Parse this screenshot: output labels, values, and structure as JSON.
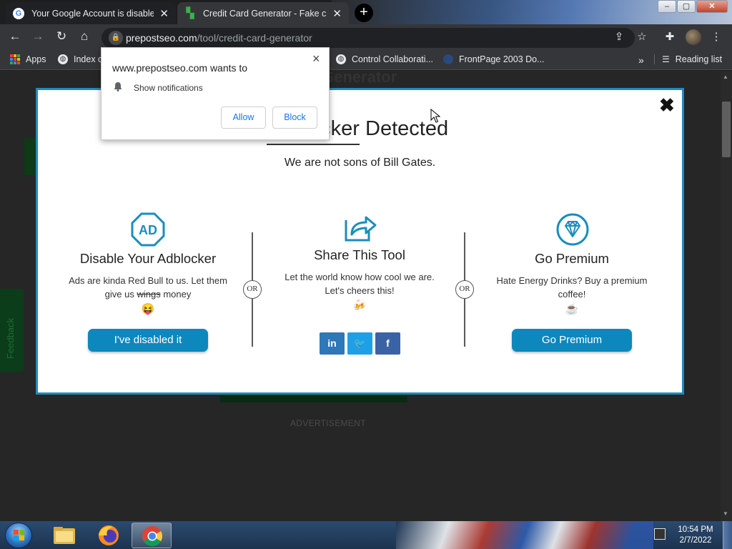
{
  "browser": {
    "tabs": [
      {
        "title": "Your Google Account is disabled",
        "favicon": "google-icon",
        "active": true
      },
      {
        "title": "Credit Card Generator - Fake cre",
        "favicon": "prepostseo-icon",
        "active": false
      }
    ],
    "new_tab": "+",
    "window_controls": {
      "minimize": "‒",
      "maximize": "▢",
      "close": "✕"
    },
    "url_host": "prepostseo.com",
    "url_path": "/tool/credit-card-generator",
    "bookmarks": [
      {
        "label": "Apps",
        "icon": "apps-grid-icon"
      },
      {
        "label": "Index c",
        "icon": "globe-icon"
      },
      {
        "label": "Control Collaborati...",
        "icon": "globe-icon"
      },
      {
        "label": "FrontPage 2003 Do...",
        "icon": "frontpage-icon"
      }
    ],
    "overflow": "»",
    "reading_list": "Reading list"
  },
  "notification": {
    "title": "www.prepostseo.com wants to",
    "permission": "Show notifications",
    "allow": "Allow",
    "block": "Block",
    "close": "×"
  },
  "modal": {
    "title": "Adblocker Detected",
    "subtitle": "We are not sons of Bill Gates.",
    "close": "✖",
    "or_label": "OR",
    "columns": [
      {
        "icon": "ad-octagon-icon",
        "heading": "Disable Your Adblocker",
        "text_before": "Ads are kinda Red Bull to us. Let them give us ",
        "strike": "wings",
        "text_after": " money",
        "emoji": "😝",
        "button": "I've disabled it"
      },
      {
        "icon": "share-icon",
        "heading": "Share This Tool",
        "text": "Let the world know how cool we are. Let's cheers this!",
        "emoji": "🍻",
        "share_buttons": [
          {
            "label": "in",
            "network": "linkedin",
            "color": "#2e77b8"
          },
          {
            "label": "🐦",
            "network": "twitter",
            "color": "#1ea0e8"
          },
          {
            "label": "f",
            "network": "facebook",
            "color": "#3a63a5"
          }
        ]
      },
      {
        "icon": "diamond-icon",
        "heading": "Go Premium",
        "text": "Hate Energy Drinks? Buy a premium coffee!",
        "emoji": "☕",
        "button": "Go Premium"
      }
    ]
  },
  "page": {
    "heading_fragment": "Generator",
    "advertisement": "ADVERTISEMENT",
    "feedback": "Feedback"
  },
  "taskbar": {
    "time": "10:54 PM",
    "date": "2/7/2022"
  },
  "colors": {
    "modal_accent": "#1d8bbf",
    "cta": "#0d88bd",
    "chrome_dark": "#35363a"
  }
}
